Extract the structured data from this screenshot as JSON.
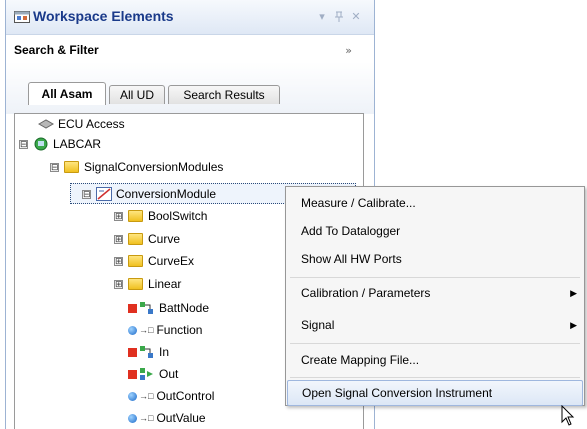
{
  "panel": {
    "title": "Workspace Elements",
    "pin_glyph": "▾",
    "pin2_glyph": "ᵾ",
    "close_glyph": "✕",
    "filter_label": "Search & Filter",
    "filter_chevron": "»"
  },
  "tabs": [
    {
      "label": "All Asam",
      "active": true
    },
    {
      "label": "All UD",
      "active": false
    },
    {
      "label": "Search Results",
      "active": false
    }
  ],
  "tree": [
    {
      "label": "ECU Access",
      "icon": "ecu-access-icon",
      "expander": null
    },
    {
      "label": "LABCAR",
      "icon": "labcar-icon",
      "expander": "⊟"
    },
    {
      "label": "SignalConversionModules",
      "icon": "folder-icon",
      "expander": "⊟"
    },
    {
      "label": "ConversionModule",
      "icon": "conversion-module-icon",
      "expander": "⊟",
      "selected": true
    },
    {
      "label": "BoolSwitch",
      "icon": "folder-icon",
      "expander": "⊞"
    },
    {
      "label": "Curve",
      "icon": "folder-icon",
      "expander": "⊞"
    },
    {
      "label": "CurveEx",
      "icon": "folder-icon",
      "expander": "⊞"
    },
    {
      "label": "Linear",
      "icon": "folder-icon",
      "expander": "⊞"
    },
    {
      "label": "BattNode",
      "icon": "node-icon",
      "expander": null
    },
    {
      "label": "Function",
      "icon": "signal-icon",
      "expander": null
    },
    {
      "label": "In",
      "icon": "node-icon",
      "expander": null
    },
    {
      "label": "Out",
      "icon": "out-node-icon",
      "expander": null
    },
    {
      "label": "OutControl",
      "icon": "signal-icon",
      "expander": null
    },
    {
      "label": "OutValue",
      "icon": "signal-icon",
      "expander": null
    }
  ],
  "context_menu": {
    "items": [
      {
        "label": "Measure / Calibrate...",
        "submenu": false
      },
      {
        "label": "Add To Datalogger",
        "submenu": false
      },
      {
        "label": "Show All HW Ports",
        "submenu": false
      },
      {
        "label": "Calibration / Parameters",
        "submenu": true
      },
      {
        "label": "Signal",
        "submenu": true
      },
      {
        "label": "Create Mapping File...",
        "submenu": false
      },
      {
        "label": "Open Signal Conversion Instrument",
        "submenu": false,
        "highlighted": true
      }
    ],
    "submenu_glyph": "▶"
  },
  "colors": {
    "title_text": "#1a3a8a",
    "highlight_border": "#9fb7de",
    "folder": "#f0c020"
  }
}
